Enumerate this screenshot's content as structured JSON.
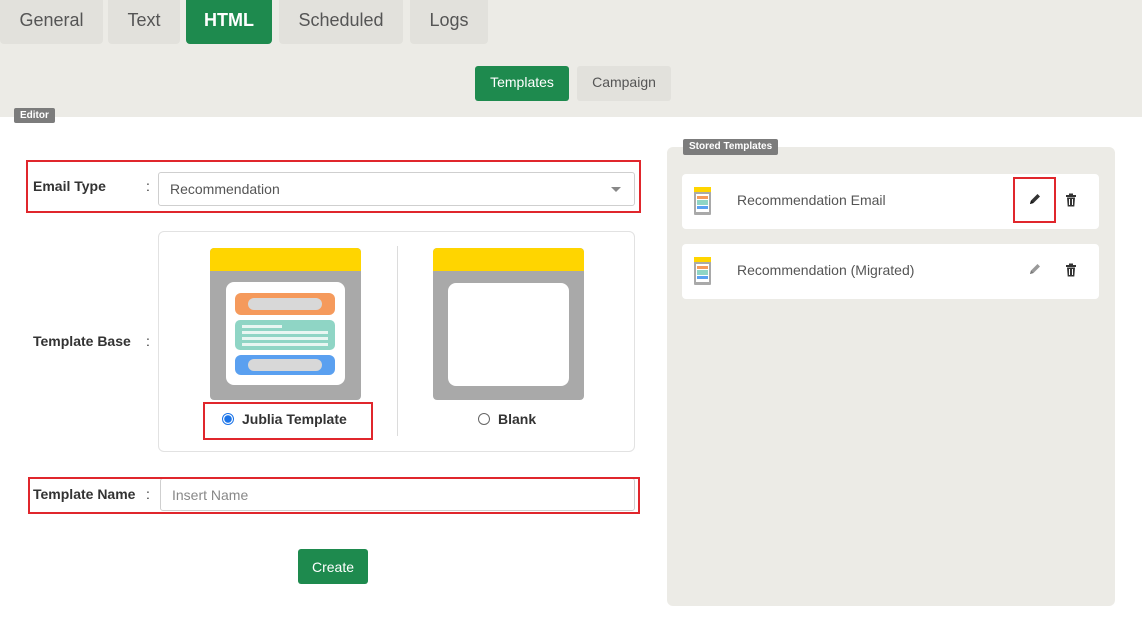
{
  "tabs": [
    {
      "label": "General",
      "active": false
    },
    {
      "label": "Text",
      "active": false
    },
    {
      "label": "HTML",
      "active": true
    },
    {
      "label": "Scheduled",
      "active": false
    },
    {
      "label": "Logs",
      "active": false
    }
  ],
  "subtabs": [
    {
      "label": "Templates",
      "active": true
    },
    {
      "label": "Campaign",
      "active": false
    }
  ],
  "editor": {
    "badge": "Editor",
    "email_type": {
      "label": "Email Type",
      "colon": ":",
      "value": "Recommendation"
    },
    "template_base": {
      "label": "Template Base",
      "colon": ":",
      "options": [
        {
          "label": "Jublia Template",
          "selected": true
        },
        {
          "label": "Blank",
          "selected": false
        }
      ]
    },
    "template_name": {
      "label": "Template Name",
      "colon": ":",
      "placeholder": "Insert Name",
      "value": ""
    },
    "create_label": "Create"
  },
  "stored": {
    "badge": "Stored Templates",
    "items": [
      {
        "name": "Recommendation Email",
        "icons": [
          "template-icon",
          "pencil-icon",
          "trash-icon"
        ]
      },
      {
        "name": "Recommendation (Migrated)",
        "icons": [
          "template-icon",
          "pencil-icon",
          "trash-icon"
        ]
      }
    ]
  },
  "colors": {
    "accent_green": "#1e8a4e",
    "highlight_red": "#e0262c",
    "template_yellow": "#ffd500",
    "panel_bg": "#ecebe6"
  }
}
